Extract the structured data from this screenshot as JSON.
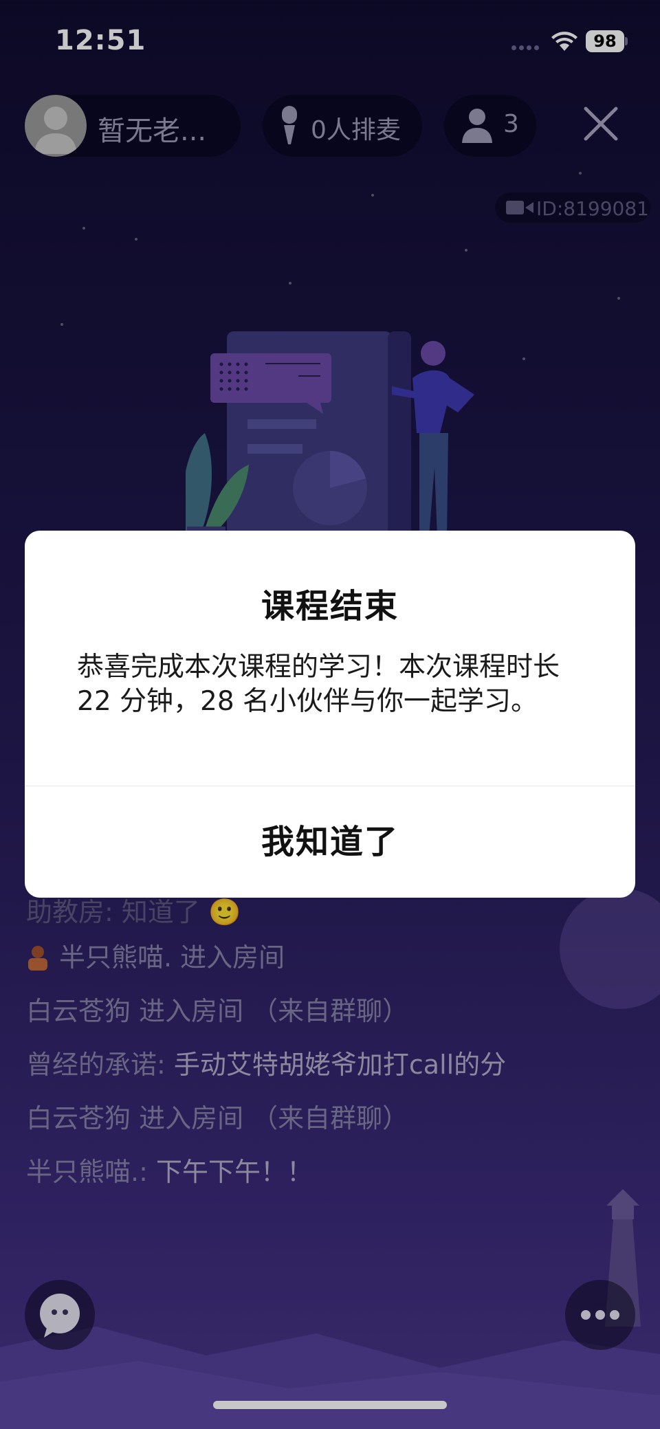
{
  "status_bar": {
    "time": "12:51",
    "battery": "98"
  },
  "top_bar": {
    "host_name": "暂无老...",
    "mic_queue": "0人排麦",
    "audience_count": "3"
  },
  "room": {
    "id_label": "ID:8199081"
  },
  "chat": {
    "partial_top": "助教房: 知道了 🙂",
    "messages": [
      {
        "name": "半只熊喵.",
        "text": " 进入房间",
        "has_avatar": true
      },
      {
        "name": "白云苍狗",
        "text": " 进入房间 （来自群聊）",
        "has_avatar": false
      },
      {
        "name": "曾经的承诺:",
        "text": " 手动艾特胡姥爷加打call的分",
        "has_avatar": false
      },
      {
        "name": "白云苍狗",
        "text": " 进入房间 （来自群聊）",
        "has_avatar": false
      },
      {
        "name": "半只熊喵.:",
        "text": " 下午下午！！",
        "has_avatar": false
      }
    ]
  },
  "dialog": {
    "title": "课程结束",
    "message": "恭喜完成本次课程的学习！本次课程时长 22 分钟，28 名小伙伴与你一起学习。",
    "confirm_label": "我知道了"
  },
  "icons": {
    "close": "close-icon",
    "mic": "mic-icon",
    "user": "user-icon",
    "video": "video-icon",
    "chat": "chat-bubble-icon",
    "more": "more-dots-icon"
  },
  "colors": {
    "background_top": "#100c30",
    "background_bottom": "#4a3589",
    "dialog_bg": "#ffffff",
    "chat_name": "#8783a8",
    "chat_text": "#b4b0cb"
  }
}
